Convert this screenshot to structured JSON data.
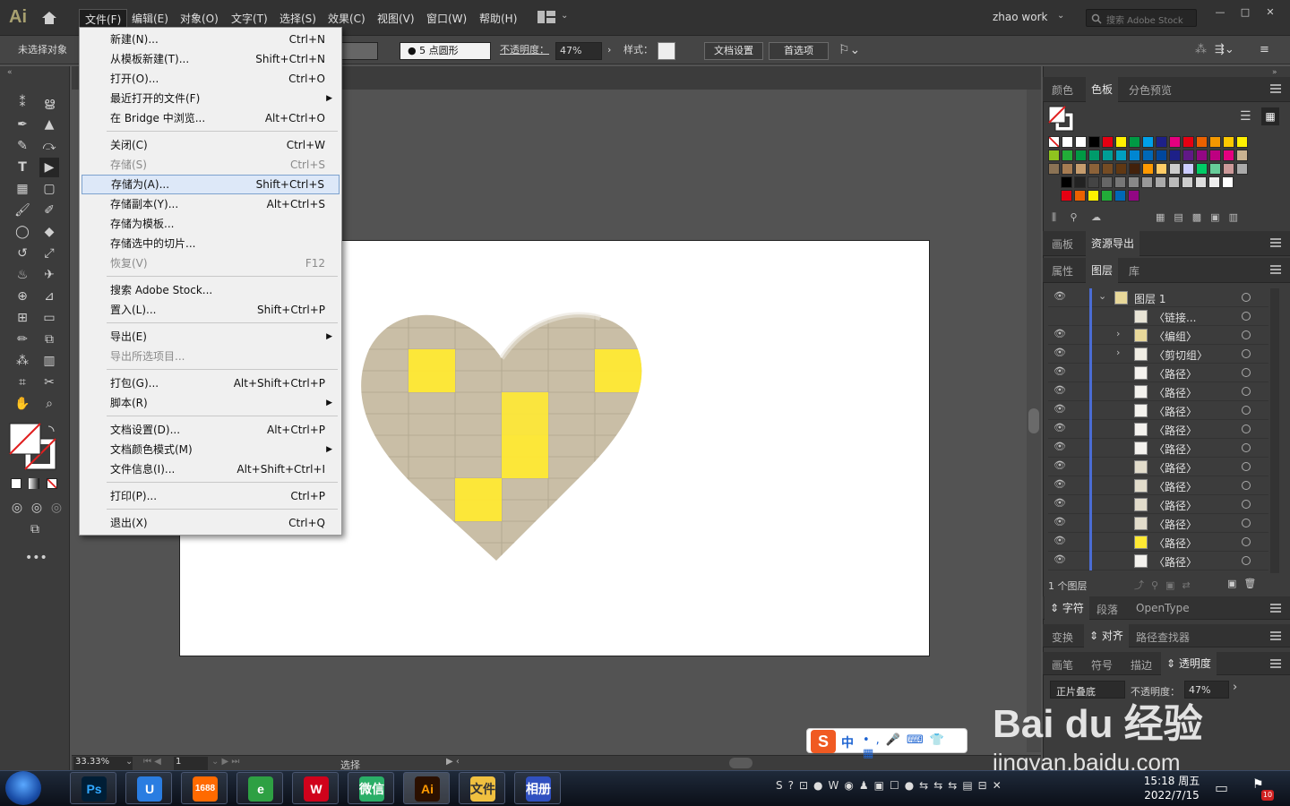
{
  "app": {
    "logo": "Ai",
    "menus": [
      "文件(F)",
      "编辑(E)",
      "对象(O)",
      "文字(T)",
      "选择(S)",
      "效果(C)",
      "视图(V)",
      "窗口(W)",
      "帮助(H)"
    ],
    "user": "zhao work",
    "search_placeholder": "搜索 Adobe Stock"
  },
  "control_bar": {
    "selection": "未选择对象",
    "brush": "5 点圆形",
    "opacity_label": "不透明度：",
    "opacity_value": "47%",
    "style_label": "样式：",
    "doc_setup": "文档设置",
    "preferences": "首选项"
  },
  "file_menu": {
    "groups": [
      [
        {
          "label": "新建(N)...",
          "shortcut": "Ctrl+N"
        },
        {
          "label": "从模板新建(T)...",
          "shortcut": "Shift+Ctrl+N"
        },
        {
          "label": "打开(O)...",
          "shortcut": "Ctrl+O"
        },
        {
          "label": "最近打开的文件(F)",
          "shortcut": "",
          "submenu": true
        },
        {
          "label": "在 Bridge 中浏览...",
          "shortcut": "Alt+Ctrl+O"
        }
      ],
      [
        {
          "label": "关闭(C)",
          "shortcut": "Ctrl+W"
        },
        {
          "label": "存储(S)",
          "shortcut": "Ctrl+S",
          "disabled": true
        },
        {
          "label": "存储为(A)...",
          "shortcut": "Shift+Ctrl+S",
          "highlighted": true
        },
        {
          "label": "存储副本(Y)...",
          "shortcut": "Alt+Ctrl+S"
        },
        {
          "label": "存储为模板...",
          "shortcut": ""
        },
        {
          "label": "存储选中的切片...",
          "shortcut": ""
        },
        {
          "label": "恢复(V)",
          "shortcut": "F12",
          "disabled": true
        }
      ],
      [
        {
          "label": "搜索 Adobe Stock...",
          "shortcut": ""
        },
        {
          "label": "置入(L)...",
          "shortcut": "Shift+Ctrl+P"
        }
      ],
      [
        {
          "label": "导出(E)",
          "shortcut": "",
          "submenu": true
        },
        {
          "label": "导出所选项目...",
          "shortcut": "",
          "disabled": true
        }
      ],
      [
        {
          "label": "打包(G)...",
          "shortcut": "Alt+Shift+Ctrl+P"
        },
        {
          "label": "脚本(R)",
          "shortcut": "",
          "submenu": true
        }
      ],
      [
        {
          "label": "文档设置(D)...",
          "shortcut": "Alt+Ctrl+P"
        },
        {
          "label": "文档颜色模式(M)",
          "shortcut": "",
          "submenu": true
        },
        {
          "label": "文件信息(I)...",
          "shortcut": "Alt+Shift+Ctrl+I"
        }
      ],
      [
        {
          "label": "打印(P)...",
          "shortcut": "Ctrl+P"
        }
      ],
      [
        {
          "label": "退出(X)",
          "shortcut": "Ctrl+Q"
        }
      ]
    ]
  },
  "panels": {
    "swatch_tabs": [
      "颜色",
      "色板",
      "分色预览"
    ],
    "artboard_tabs": [
      "画板",
      "资源导出"
    ],
    "layers_tabs": [
      "属性",
      "图层",
      "库"
    ],
    "layer_top": "图层 1",
    "layers": [
      {
        "name": "〈链接...",
        "eye": false,
        "arrow": false,
        "thumb": "#e8e4d6"
      },
      {
        "name": "〈编组〉",
        "eye": true,
        "arrow": true,
        "thumb": "#e8d89a"
      },
      {
        "name": "〈剪切组〉",
        "eye": true,
        "arrow": true,
        "thumb": "#f0ede4"
      },
      {
        "name": "〈路径〉",
        "eye": true,
        "arrow": false,
        "thumb": "#f4f2ee"
      },
      {
        "name": "〈路径〉",
        "eye": true,
        "arrow": false,
        "thumb": "#f4f2ee"
      },
      {
        "name": "〈路径〉",
        "eye": true,
        "arrow": false,
        "thumb": "#f4f2ee"
      },
      {
        "name": "〈路径〉",
        "eye": true,
        "arrow": false,
        "thumb": "#f4f2ee"
      },
      {
        "name": "〈路径〉",
        "eye": true,
        "arrow": false,
        "thumb": "#f4f2ee"
      },
      {
        "name": "〈路径〉",
        "eye": true,
        "arrow": false,
        "thumb": "#e2dccb"
      },
      {
        "name": "〈路径〉",
        "eye": true,
        "arrow": false,
        "thumb": "#e2dccb"
      },
      {
        "name": "〈路径〉",
        "eye": true,
        "arrow": false,
        "thumb": "#e2dccb"
      },
      {
        "name": "〈路径〉",
        "eye": true,
        "arrow": false,
        "thumb": "#e2dccb"
      },
      {
        "name": "〈路径〉",
        "eye": true,
        "arrow": false,
        "thumb": "#ffe933"
      },
      {
        "name": "〈路径〉",
        "eye": true,
        "arrow": false,
        "thumb": "#f4f2ee"
      }
    ],
    "layer_count": "1 个图层",
    "char_tabs": [
      "字符",
      "段落",
      "OpenType"
    ],
    "align_tabs": [
      "变换",
      "对齐",
      "路径查找器"
    ],
    "transp_tabs": [
      "画笔",
      "符号",
      "描边",
      "透明度"
    ],
    "blend_mode": "正片叠底",
    "transp_opacity_label": "不透明度：",
    "transp_opacity": "47%"
  },
  "status": {
    "zoom": "33.33%",
    "page": "1",
    "mode": "选择"
  },
  "taskbar": {
    "time": "15:18 周五",
    "date": "2022/7/15",
    "apps": [
      "Ps",
      "U",
      "1688",
      "e",
      "W",
      "微信",
      "Ai",
      "文件",
      "相册"
    ],
    "badge": "10"
  },
  "ime": {
    "logo": "S",
    "lang": "中"
  },
  "watermark": {
    "brand": "Bai du 经验",
    "url": "jingyan.baidu.com"
  },
  "colors": {
    "accent": "#4a6cd4",
    "highlight": "#dde8f8",
    "heart": "#c9bea6",
    "yellow": "#ffe933"
  }
}
